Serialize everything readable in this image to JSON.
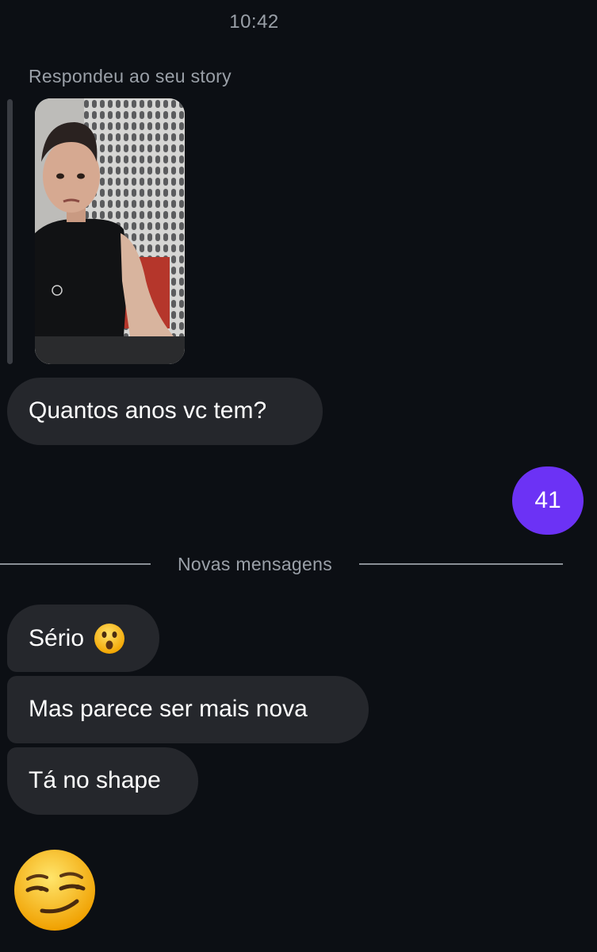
{
  "header": {
    "time": "10:42"
  },
  "story_reply": {
    "label": "Respondeu ao seu story"
  },
  "messages": {
    "received_1": "Quantos anos vc tem?",
    "sent_1": "41",
    "received_2_text": "Sério",
    "received_2_emoji": "astonished-face-emoji",
    "received_3": "Mas parece ser mais nova",
    "received_4": "Tá no shape",
    "received_5_emoji": "smirking-face-emoji"
  },
  "divider": {
    "label": "Novas mensagens"
  },
  "colors": {
    "background": "#0c0f14",
    "received_bubble": "#25272c",
    "sent_bubble": "#6c32f5",
    "muted_text": "#9aa0a8"
  }
}
